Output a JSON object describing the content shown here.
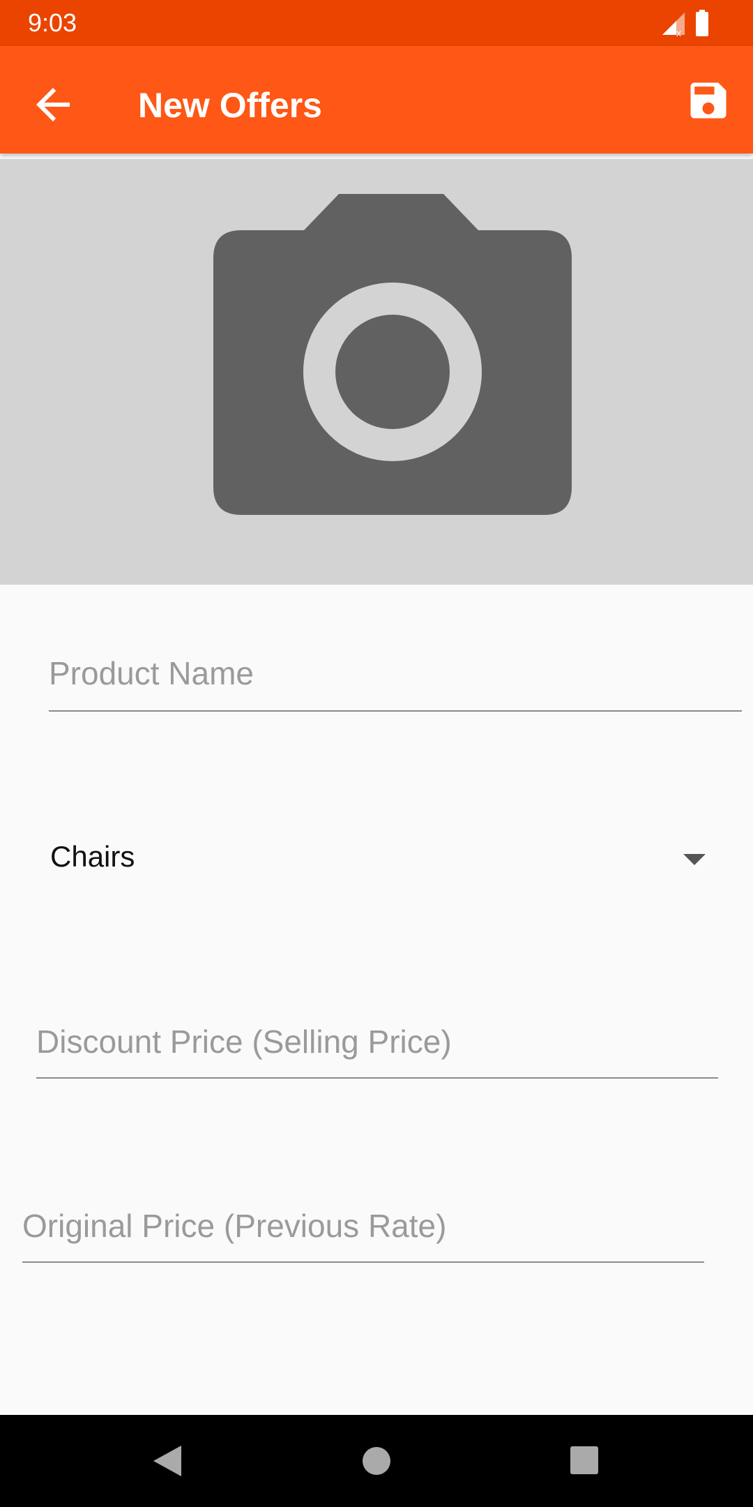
{
  "status": {
    "time": "9:03"
  },
  "appbar": {
    "title": "New Offers",
    "back_icon": "arrow-back-icon",
    "save_icon": "floppy-save-icon"
  },
  "image_picker": {
    "icon": "camera-icon"
  },
  "form": {
    "product_name": {
      "placeholder": "Product Name",
      "value": ""
    },
    "category": {
      "selected": "Chairs"
    },
    "discount_price": {
      "placeholder": "Discount Price (Selling Price)",
      "value": ""
    },
    "original_price": {
      "placeholder": "Original Price (Previous Rate)",
      "value": ""
    }
  },
  "colors": {
    "status_bar": "#ea4400",
    "app_bar": "#ff5716",
    "image_bg": "#d3d3d3",
    "camera": "#616161"
  }
}
